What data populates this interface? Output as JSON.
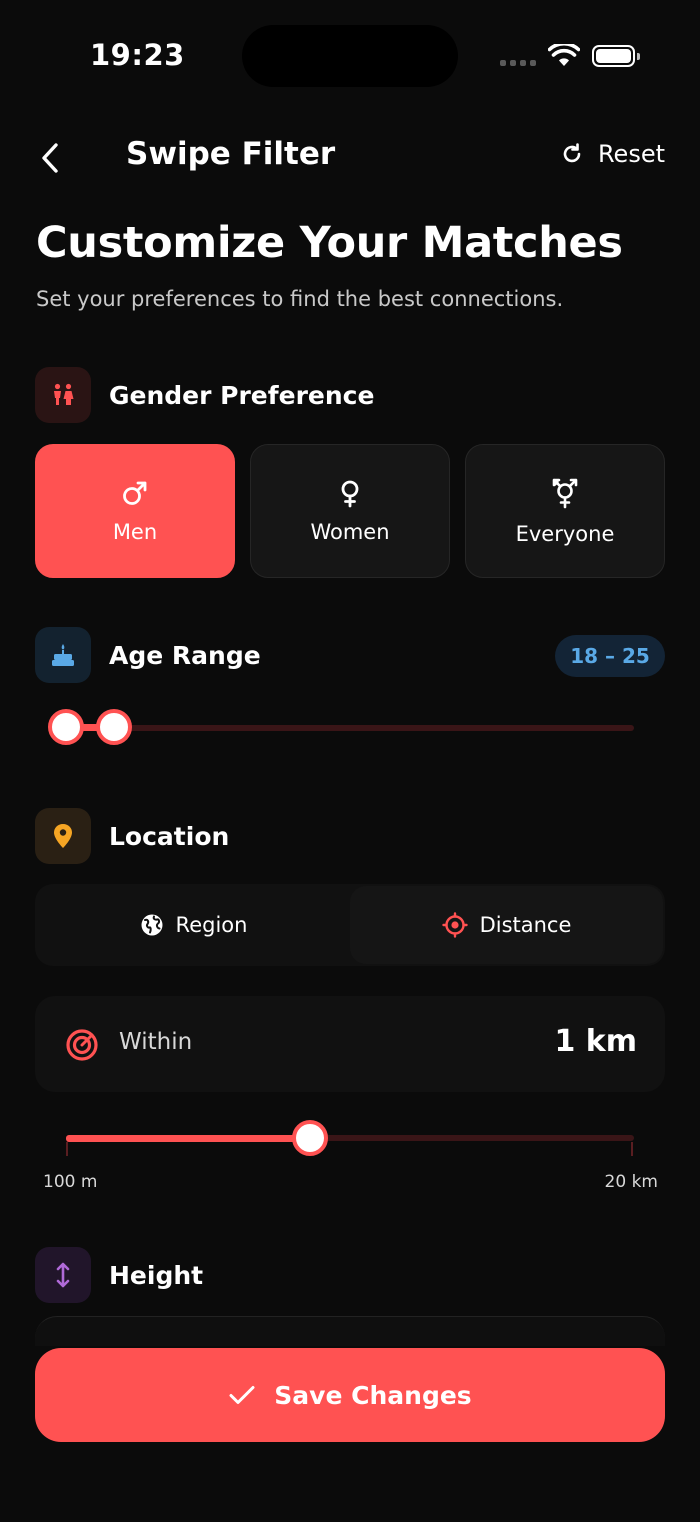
{
  "status_bar": {
    "time": "19:23"
  },
  "header": {
    "title": "Swipe Filter",
    "reset_label": "Reset"
  },
  "page": {
    "title": "Customize Your Matches",
    "subtitle": "Set your preferences to find the best connections."
  },
  "gender": {
    "label": "Gender Preference",
    "options": [
      {
        "label": "Men",
        "icon": "male-icon",
        "selected": true
      },
      {
        "label": "Women",
        "icon": "female-icon",
        "selected": false
      },
      {
        "label": "Everyone",
        "icon": "transgender-icon",
        "selected": false
      }
    ]
  },
  "age": {
    "label": "Age Range",
    "badge": "18 – 25",
    "min_value": 18,
    "max_value": 25
  },
  "location": {
    "label": "Location",
    "modes": [
      {
        "label": "Region",
        "icon": "globe-icon",
        "selected": false
      },
      {
        "label": "Distance",
        "icon": "crosshair-icon",
        "selected": true
      }
    ],
    "within_label": "Within",
    "within_value": "1 km",
    "range_min_label": "100 m",
    "range_max_label": "20 km",
    "slider_fraction": 0.43
  },
  "height": {
    "label": "Height"
  },
  "save_label": "Save Changes",
  "colors": {
    "accent": "#ff5252",
    "age_badge_text": "#5aa9e6",
    "location_icon": "#f5a524",
    "height_icon": "#b06ad8",
    "gender_icon": "#ff5252"
  }
}
